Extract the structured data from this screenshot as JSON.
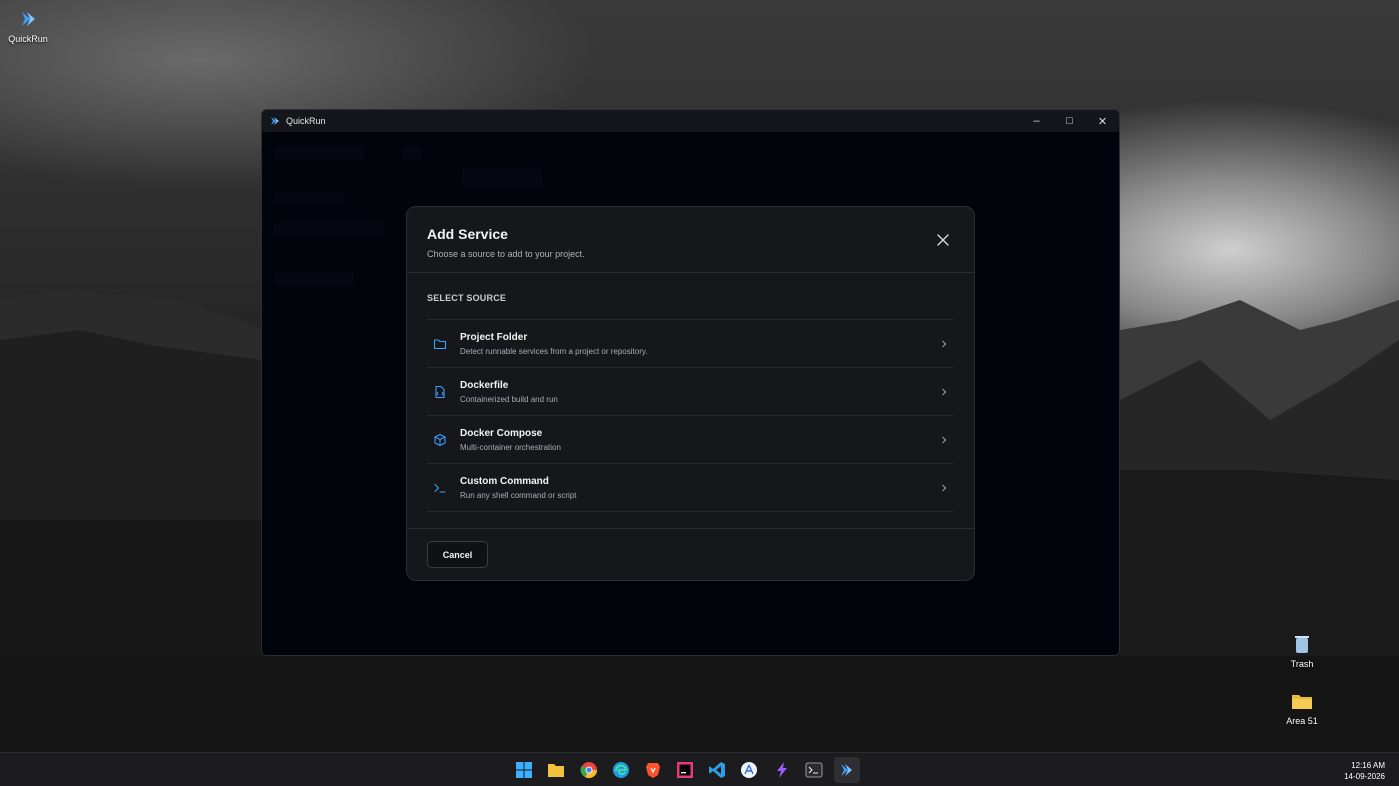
{
  "desktop": {
    "icons": [
      {
        "label": "QuickRun"
      },
      {
        "label": "Trash"
      },
      {
        "label": "Area 51"
      }
    ]
  },
  "window": {
    "title": "QuickRun",
    "controls": {
      "minimize": "–",
      "maximize": "□",
      "close": "✕"
    }
  },
  "modal": {
    "title": "Add Service",
    "subtitle": "Choose a source to add to your project.",
    "section_label": "SELECT SOURCE",
    "options": [
      {
        "name": "Project Folder",
        "description": "Detect runnable services from a project or repository.",
        "icon": "folder-icon"
      },
      {
        "name": "Dockerfile",
        "description": "Containerized build and run",
        "icon": "file-icon"
      },
      {
        "name": "Docker Compose",
        "description": "Multi-container orchestration",
        "icon": "cube-icon"
      },
      {
        "name": "Custom Command",
        "description": "Run any shell command or script",
        "icon": "terminal-icon"
      }
    ],
    "cancel_label": "Cancel"
  },
  "taskbar": {
    "time": "12:16 AM",
    "date": "14-09-2026"
  },
  "colors": {
    "accent": "#3aa0ff",
    "modal_bg": "#16171b",
    "window_bg": "#04070f"
  }
}
